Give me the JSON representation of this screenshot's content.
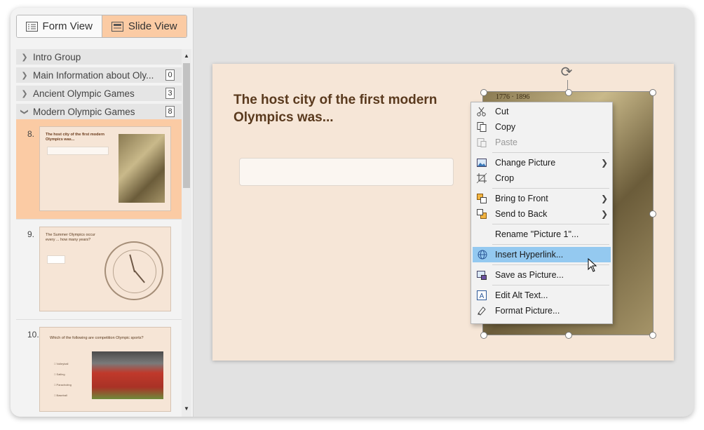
{
  "view_toggle": {
    "form_label": "Form View",
    "slide_label": "Slide View"
  },
  "outline": {
    "groups": [
      {
        "label": "Intro Group",
        "count": ""
      },
      {
        "label": "Main Information about Oly...",
        "count": "0"
      },
      {
        "label": "Ancient Olympic Games",
        "count": "3"
      },
      {
        "label": "Modern Olympic Games",
        "count": "8"
      }
    ],
    "slides": [
      {
        "number": "8.",
        "thumb_text": "The host city of the first modern Olympics was..."
      },
      {
        "number": "9.",
        "thumb_text": "The Summer Olympics occur every ... how many years?"
      },
      {
        "number": "10.",
        "thumb_text": "Which of the following are competition Olympic sports?"
      }
    ],
    "slide10_options": [
      "Volleyball",
      "Sailing",
      "Parachuting",
      "Baseball"
    ]
  },
  "slide": {
    "question": "The host city of the first modern Olympics was...",
    "picture_caption": "1776 · 1896"
  },
  "context_menu": {
    "items": [
      {
        "label": "Cut",
        "icon": "scissors-icon"
      },
      {
        "label": "Copy",
        "icon": "copy-icon"
      },
      {
        "label": "Paste",
        "icon": "paste-icon"
      },
      {
        "label": "Change Picture",
        "icon": "change-picture-icon"
      },
      {
        "label": "Crop",
        "icon": "crop-icon"
      },
      {
        "label": "Bring to Front",
        "icon": "bring-to-front-icon"
      },
      {
        "label": "Send to Back",
        "icon": "send-to-back-icon"
      },
      {
        "label": "Rename \"Picture 1\"...",
        "icon": ""
      },
      {
        "label": "Insert Hyperlink...",
        "icon": "hyperlink-icon"
      },
      {
        "label": "Save as Picture...",
        "icon": "save-picture-icon"
      },
      {
        "label": "Edit Alt Text...",
        "icon": "alt-text-icon"
      },
      {
        "label": "Format Picture...",
        "icon": "format-picture-icon"
      }
    ]
  },
  "colors": {
    "accent": "#fbcba4",
    "slide_bg": "#f6e6d7",
    "question_text": "#5a3a1e",
    "menu_hover": "#94c9f0"
  }
}
